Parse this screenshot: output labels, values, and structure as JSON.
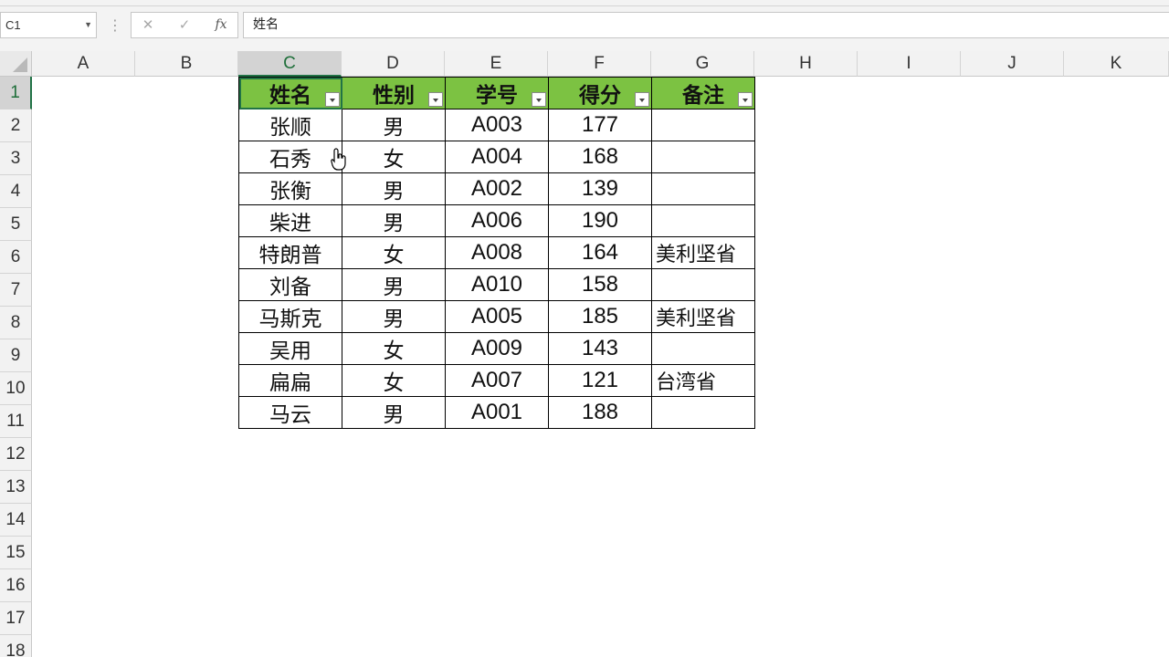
{
  "name_box": {
    "value": "C1"
  },
  "formula_bar": {
    "cancel_symbol": "✕",
    "enter_symbol": "✓",
    "fx_label": "fx",
    "content": "姓名"
  },
  "columns": [
    "A",
    "B",
    "C",
    "D",
    "E",
    "F",
    "G",
    "H",
    "I",
    "J",
    "K"
  ],
  "selected_column": "C",
  "rows": [
    "1",
    "2",
    "3",
    "4",
    "5",
    "6",
    "7",
    "8",
    "9",
    "10",
    "11",
    "12",
    "13",
    "14",
    "15",
    "16",
    "17",
    "18"
  ],
  "selected_row": "1",
  "table": {
    "headers": [
      "姓名",
      "性别",
      "学号",
      "得分",
      "备注"
    ],
    "rows": [
      [
        "张顺",
        "男",
        "A003",
        "177",
        ""
      ],
      [
        "石秀",
        "女",
        "A004",
        "168",
        ""
      ],
      [
        "张衡",
        "男",
        "A002",
        "139",
        ""
      ],
      [
        "柴进",
        "男",
        "A006",
        "190",
        ""
      ],
      [
        "特朗普",
        "女",
        "A008",
        "164",
        "美利坚省"
      ],
      [
        "刘备",
        "男",
        "A010",
        "158",
        ""
      ],
      [
        "马斯克",
        "男",
        "A005",
        "185",
        "美利坚省"
      ],
      [
        "吴用",
        "女",
        "A009",
        "143",
        ""
      ],
      [
        "扁扁",
        "女",
        "A007",
        "121",
        "台湾省"
      ],
      [
        "马云",
        "男",
        "A001",
        "188",
        ""
      ]
    ]
  },
  "colors": {
    "header_fill": "#7cc242",
    "selection_accent": "#217346"
  }
}
